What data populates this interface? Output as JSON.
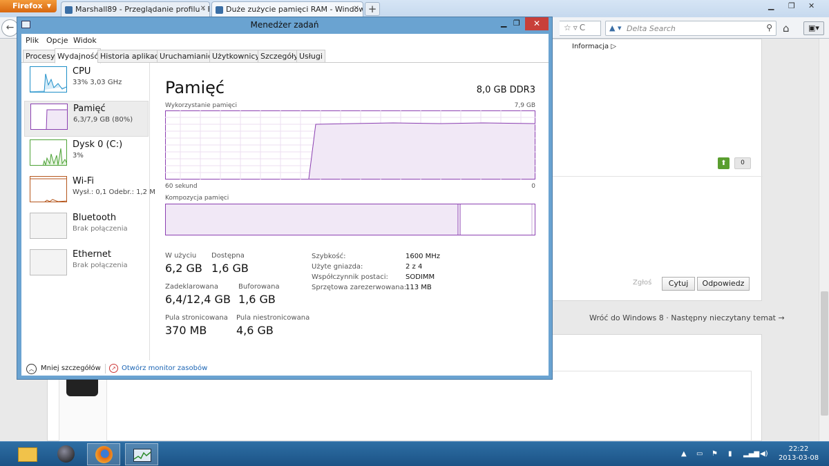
{
  "browser": {
    "menu_button": "Firefox",
    "tabs": [
      {
        "label": "Marshall89 - Przeglądanie profilu - Fo..."
      },
      {
        "label": "Duże zużycie pamięci RAM - Window..."
      }
    ],
    "search_placeholder": "Delta Search",
    "search_engine_mark": "▲ ▾"
  },
  "forum": {
    "info_label": "Informacja ▷",
    "score": "0",
    "report_label": "Zgłoś",
    "quote_label": "Cytuj",
    "reply_label": "Odpowiedz",
    "back_link": "Wróć do Windows 8",
    "next_link": "Następny nieczytany temat →",
    "separator": "·"
  },
  "task_manager": {
    "title": "Menedżer zadań",
    "menu": [
      "Plik",
      "Opcje",
      "Widok"
    ],
    "tabs": [
      "Procesy",
      "Wydajność",
      "Historia aplikacji",
      "Uruchamianie",
      "Użytkownicy",
      "Szczegóły",
      "Usługi"
    ],
    "active_tab": "Wydajność",
    "sidebar": [
      {
        "name": "CPU",
        "sub": "33% 3,03 GHz"
      },
      {
        "name": "Pamięć",
        "sub": "6,3/7,9 GB (80%)"
      },
      {
        "name": "Dysk 0 (C:)",
        "sub": "3%"
      },
      {
        "name": "Wi-Fi",
        "sub": "Wysł.: 0,1 Odebr.: 1,2 M"
      },
      {
        "name": "Bluetooth",
        "sub": "Brak połączenia"
      },
      {
        "name": "Ethernet",
        "sub": "Brak połączenia"
      }
    ],
    "memory": {
      "heading": "Pamięć",
      "total": "8,0 GB DDR3",
      "usage_label": "Wykorzystanie pamięci",
      "usage_max": "7,9 GB",
      "axis_left": "60 sekund",
      "axis_right": "0",
      "composition_label": "Kompozycja pamięci",
      "stats": {
        "in_use_label": "W użyciu",
        "in_use": "6,2 GB",
        "available_label": "Dostępna",
        "available": "1,6 GB",
        "committed_label": "Zadeklarowana",
        "committed": "6,4/12,4 GB",
        "cached_label": "Buforowana",
        "cached": "1,6 GB",
        "paged_label": "Pula stronicowana",
        "paged": "370 MB",
        "nonpaged_label": "Pula niestronicowana",
        "nonpaged": "4,6 GB"
      },
      "details": [
        {
          "k": "Szybkość:",
          "v": "1600 MHz"
        },
        {
          "k": "Użyte gniazda:",
          "v": "2 z 4"
        },
        {
          "k": "Współczynnik postaci:",
          "v": "SODIMM"
        },
        {
          "k": "Sprzętowa zarezerwowana:",
          "v": "113 MB"
        }
      ]
    },
    "footer": {
      "less_details": "Mniej szczegółów",
      "resource_monitor": "Otwórz monitor zasobów"
    }
  },
  "taskbar": {
    "time": "22:22",
    "date": "2013-03-08"
  }
}
